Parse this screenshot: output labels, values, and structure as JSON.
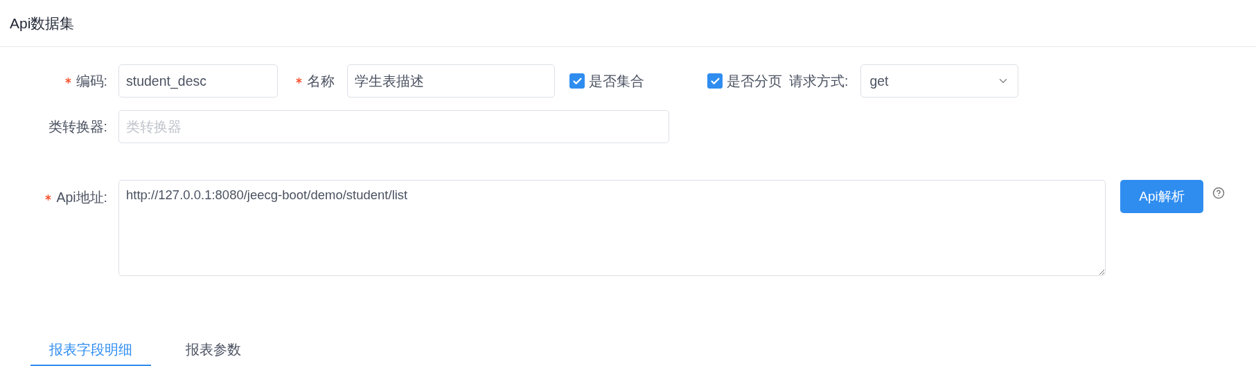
{
  "header": {
    "title": "Api数据集"
  },
  "fields": [
    {
      "kind": "input",
      "label": "编码:",
      "required": true,
      "value": "student_desc"
    },
    {
      "kind": "input",
      "label": "名称",
      "required": true,
      "value": "学生表描述"
    },
    {
      "kind": "checkbox",
      "label": "是否集合",
      "checked": true
    },
    {
      "kind": "checkbox",
      "label": "是否分页",
      "checked": true
    },
    {
      "kind": "select",
      "label": "请求方式:",
      "required": false,
      "value": "get"
    },
    {
      "kind": "input",
      "label": "类转换器:",
      "required": false,
      "placeholder": "类转换器"
    },
    {
      "kind": "textarea",
      "label": "Api地址:",
      "required": true,
      "value": "http://127.0.0.1:8080/jeecg-boot/demo/student/list"
    }
  ],
  "parse_button": "Api解析",
  "tabs": [
    {
      "label": "报表字段明细",
      "selected": true
    },
    {
      "label": "报表参数",
      "selected": false
    }
  ]
}
